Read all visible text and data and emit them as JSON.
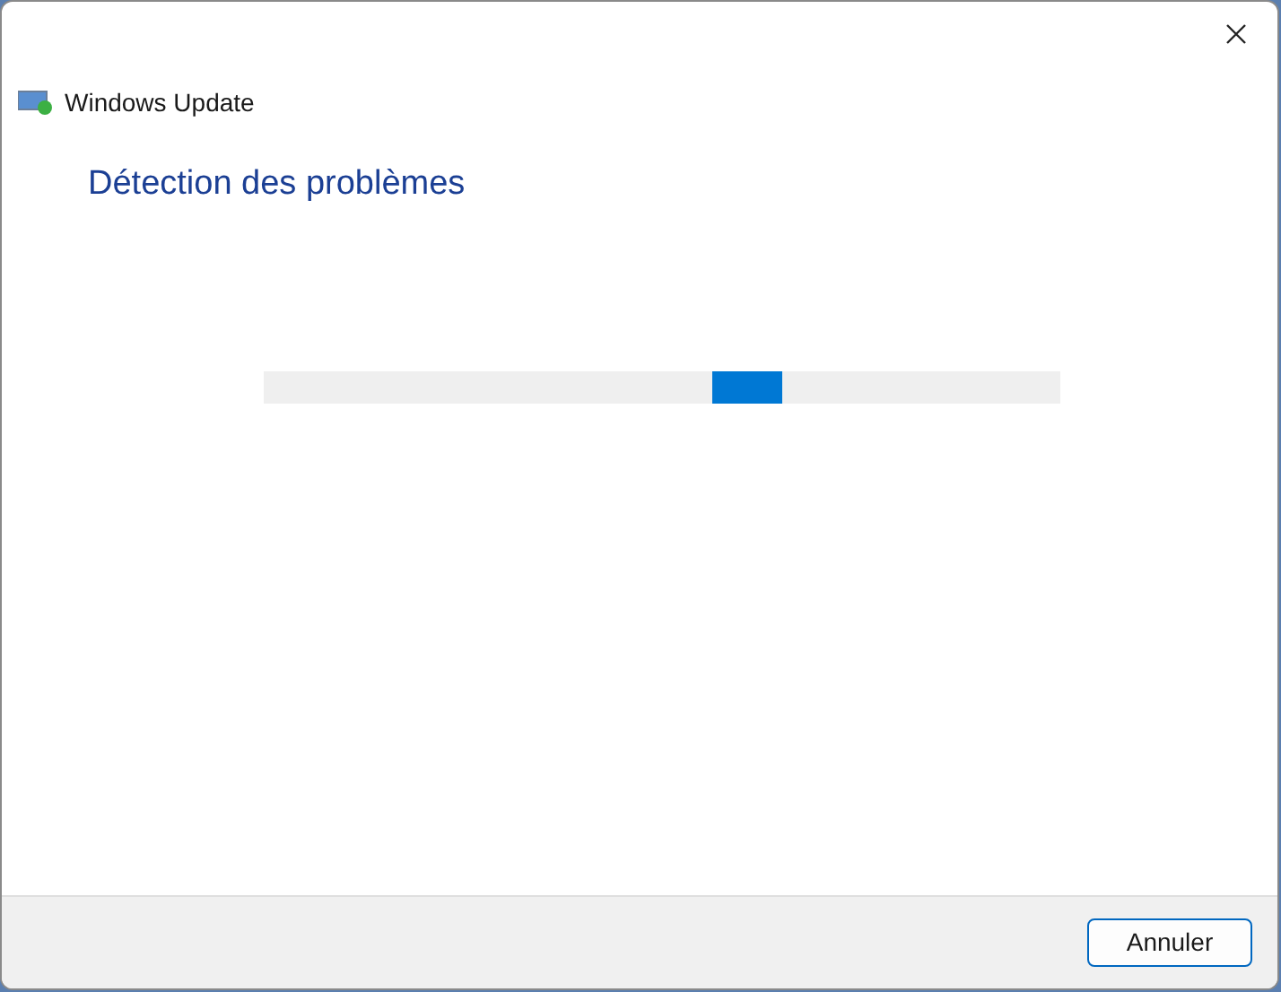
{
  "window": {
    "app_name": "Windows Update"
  },
  "heading": "Détection des problèmes",
  "progress": {
    "kind": "marquee"
  },
  "buttons": [
    {
      "label": "Annuler"
    }
  ]
}
